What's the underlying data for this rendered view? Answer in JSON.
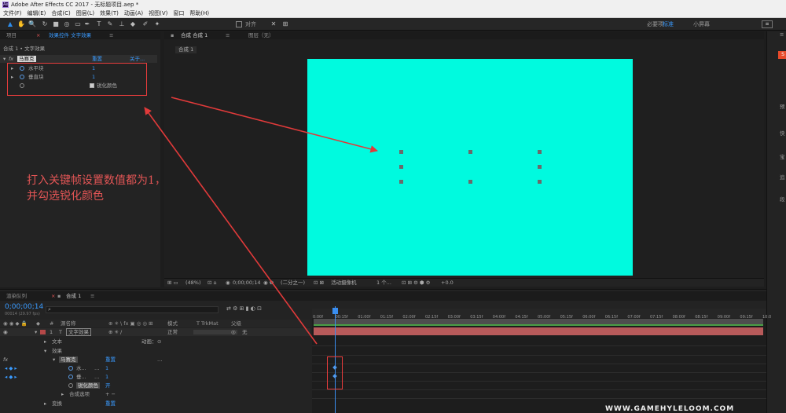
{
  "window": {
    "title": "Adobe After Effects CC 2017 - 无标题项目.aep *",
    "app_icon": "Ae"
  },
  "menu": [
    "文件(F)",
    "编辑(E)",
    "合成(C)",
    "图层(L)",
    "效果(T)",
    "动画(A)",
    "视图(V)",
    "窗口",
    "帮助(H)"
  ],
  "toolbar": {
    "align_label": "对齐",
    "workspaces": [
      "必要项",
      "标准",
      "小屏幕"
    ],
    "active_workspace": "标准",
    "search_label": "≡"
  },
  "effect_panel": {
    "tabs": [
      "项目",
      "效果控件 文字效果"
    ],
    "breadcrumb": "合成 1 • 文字效果",
    "effect_name": "马赛克",
    "reset_label": "重置",
    "about_label": "关于...",
    "props": [
      {
        "name": "水平块",
        "value": "1"
      },
      {
        "name": "垂直块",
        "value": "1"
      }
    ],
    "checkbox_label": "锐化颜色"
  },
  "comp_panel": {
    "tab_label": "合成 合成 1",
    "layer_tab": "图层（无）",
    "subtab": "合成 1",
    "zoom": "(48%)",
    "timecode": "0;00;00;14",
    "resolution": "(二分之一)",
    "camera": "活动摄像机",
    "views": "1 个...",
    "exposure": "+0.0",
    "canvas_color": "#00FADF"
  },
  "timeline": {
    "tabs": [
      "渲染队列",
      "合成 1"
    ],
    "timecode": "0;00;00;14",
    "fps": "00014 (29.97 fps)",
    "columns": {
      "name": "源名称",
      "mode": "模式",
      "trkmat": "T  TrkMat",
      "parent": "父级"
    },
    "layer": {
      "index": "1",
      "type": "T",
      "name": "文字效果",
      "mode": "正常",
      "parent": "无"
    },
    "rows": {
      "text": "文本",
      "animate": "动画：",
      "effects": "效果",
      "mosaic": "马赛克",
      "reset": "重置",
      "h_blocks": "水...",
      "v_blocks": "垂...",
      "h_value": "1",
      "v_value": "1",
      "sharpen": "锐化颜色",
      "sharpen_value": "开",
      "comp_options": "合成选项",
      "comp_options_value": "+ −",
      "transform": "变换",
      "transform_reset": "重置"
    },
    "ruler_labels": [
      "0:00f",
      "00:15f",
      "01:00f",
      "01:15f",
      "02:00f",
      "02:15f",
      "03:00f",
      "03:15f",
      "04:00f",
      "04:15f",
      "05:00f",
      "05:15f",
      "06:00f",
      "06:15f",
      "07:00f",
      "07:15f",
      "08:00f",
      "08:15f",
      "09:00f",
      "09:15f",
      "10:0"
    ],
    "colors": {
      "layer_bar": "#B75A5A",
      "playhead": "#3A8EF0"
    }
  },
  "annotation": {
    "line1": "打入关键帧设置数值都为1，",
    "line2": "并勾选锐化颜色",
    "color": "#E25555"
  },
  "right_strip": {
    "labels": [
      "预",
      "快",
      "宝",
      "追",
      "段"
    ]
  },
  "watermark": "WWW.GAMEHYLELOOM.COM"
}
